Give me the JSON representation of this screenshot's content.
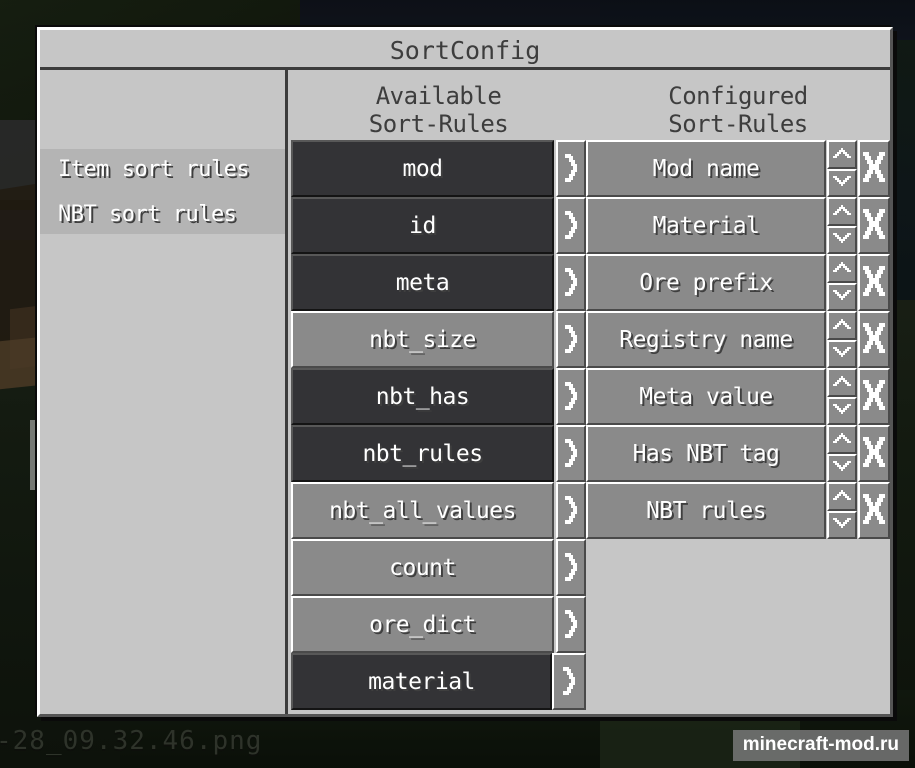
{
  "window": {
    "title": "SortConfig"
  },
  "sidebar": {
    "items": [
      {
        "label": "Item sort rules",
        "selected": true
      },
      {
        "label": "NBT sort rules",
        "selected": true
      }
    ]
  },
  "available": {
    "header_line1": "Available",
    "header_line2": "Sort-Rules",
    "add_icon": "chevron-right-icon",
    "rules": [
      {
        "label": "mod",
        "state": "dark"
      },
      {
        "label": "id",
        "state": "dark"
      },
      {
        "label": "meta",
        "state": "dark"
      },
      {
        "label": "nbt_size",
        "state": "light"
      },
      {
        "label": "nbt_has",
        "state": "dark"
      },
      {
        "label": "nbt_rules",
        "state": "dark"
      },
      {
        "label": "nbt_all_values",
        "state": "light"
      },
      {
        "label": "count",
        "state": "light"
      },
      {
        "label": "ore_dict",
        "state": "light"
      },
      {
        "label": "material",
        "state": "dark",
        "arrow_hot": true
      }
    ]
  },
  "configured": {
    "header_line1": "Configured",
    "header_line2": "Sort-Rules",
    "move_up_icon": "chevron-up-icon",
    "move_down_icon": "chevron-down-icon",
    "remove_icon": "close-x-icon",
    "rules": [
      {
        "label": "Mod name"
      },
      {
        "label": "Material"
      },
      {
        "label": "Ore prefix"
      },
      {
        "label": "Registry name"
      },
      {
        "label": "Meta value"
      },
      {
        "label": "Has NBT tag"
      },
      {
        "label": "NBT rules"
      }
    ]
  },
  "overlay": {
    "watermark": "minecraft-mod.ru",
    "background_filename": "-28_09.32.46.png"
  },
  "colors": {
    "panel_bg": "#c6c6c6",
    "button_light": "#8a8a8a",
    "button_dark": "#333336",
    "text_light": "#ffffff",
    "text_dark": "#3d3d3d"
  }
}
